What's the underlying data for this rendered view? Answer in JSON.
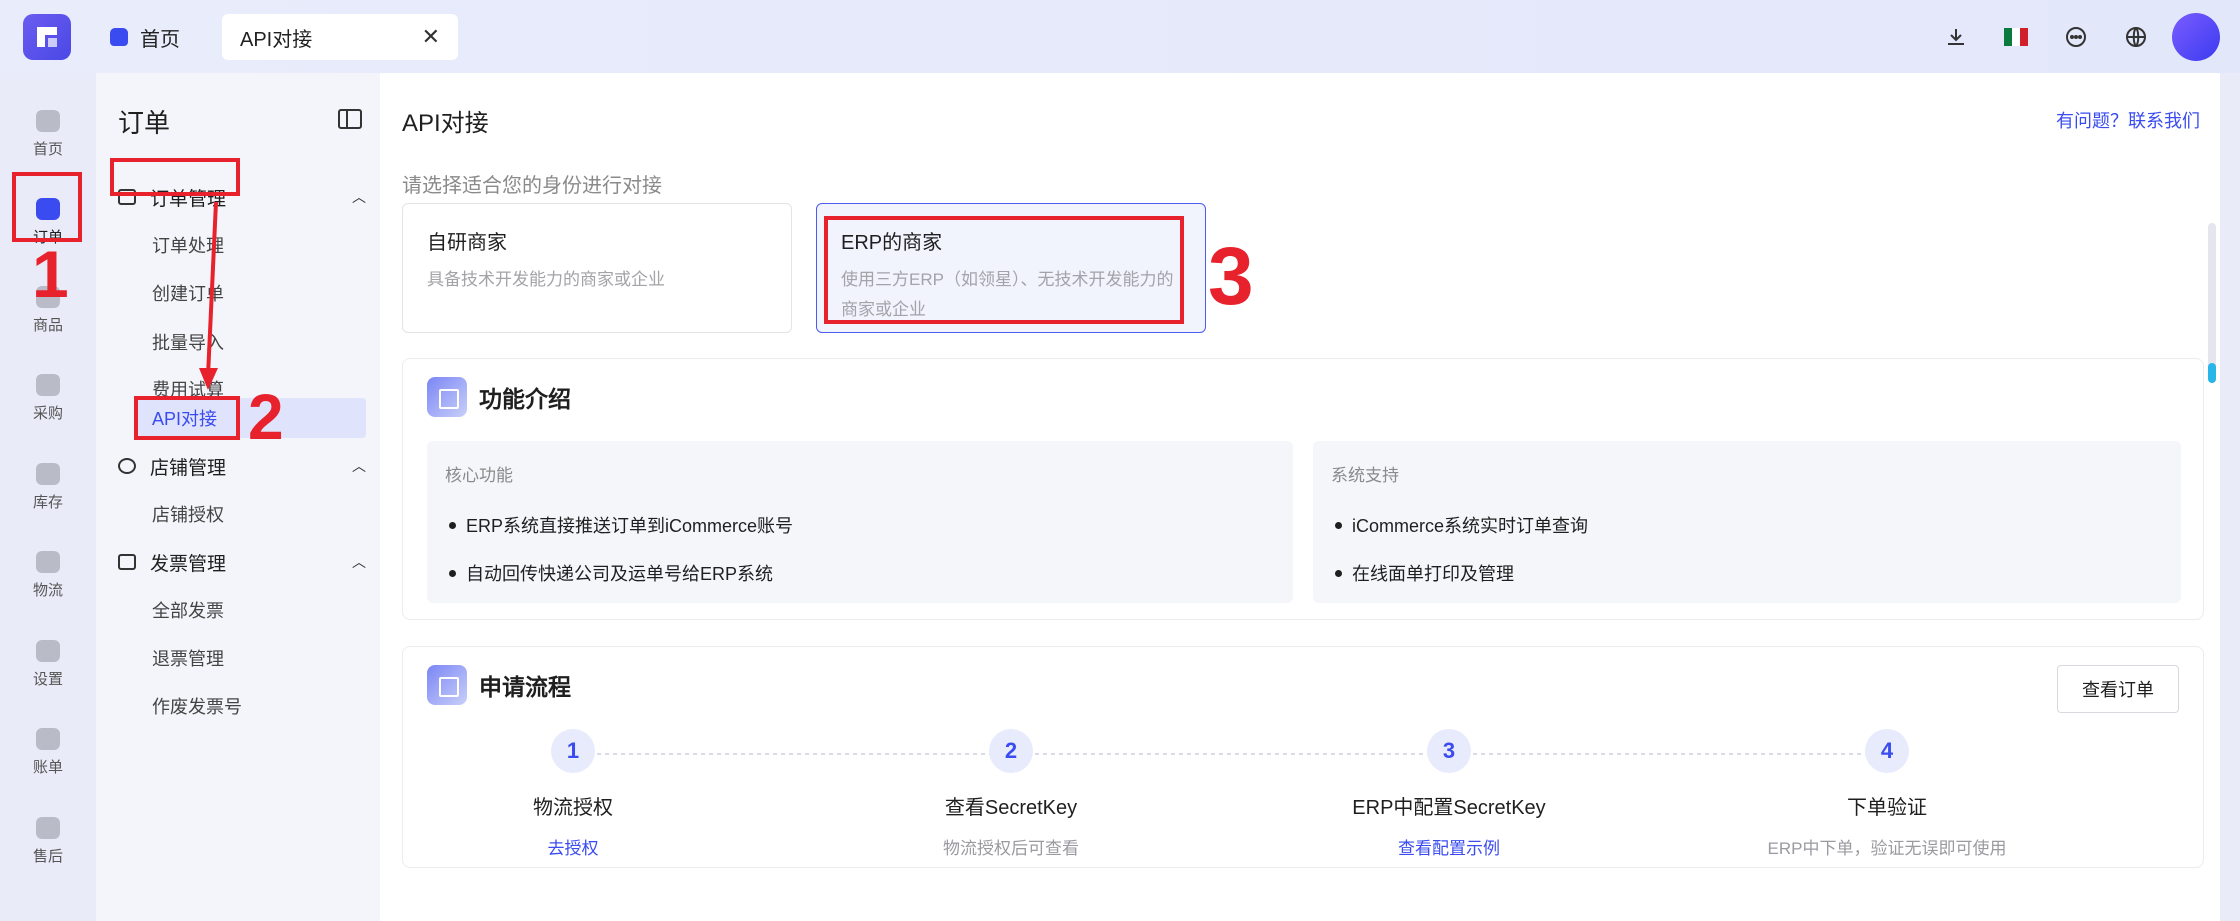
{
  "topbar": {
    "home_tab_label": "首页",
    "active_tab_label": "API对接",
    "close_glyph": "✕"
  },
  "rail": {
    "items": [
      {
        "label": "首页",
        "icon": "home-icon"
      },
      {
        "label": "订单",
        "icon": "order-icon"
      },
      {
        "label": "商品",
        "icon": "product-icon"
      },
      {
        "label": "采购",
        "icon": "purchase-icon"
      },
      {
        "label": "库存",
        "icon": "warehouse-icon"
      },
      {
        "label": "物流",
        "icon": "logistics-icon"
      },
      {
        "label": "设置",
        "icon": "settings-icon"
      },
      {
        "label": "账单",
        "icon": "bill-icon"
      },
      {
        "label": "售后",
        "icon": "after-sales-icon"
      }
    ]
  },
  "sidebar": {
    "title": "订单",
    "groups": [
      {
        "label": "订单管理",
        "children": [
          "订单处理",
          "创建订单",
          "批量导入",
          "费用试算",
          "API对接"
        ]
      },
      {
        "label": "店铺管理",
        "children": [
          "店铺授权"
        ]
      },
      {
        "label": "发票管理",
        "children": [
          "全部发票",
          "退票管理",
          "作废发票号"
        ]
      }
    ]
  },
  "main": {
    "title": "API对接",
    "help_link": "有问题？联系我们",
    "choose_label": "请选择适合您的身份进行对接",
    "identities": [
      {
        "title": "自研商家",
        "desc": "具备技术开发能力的商家或企业"
      },
      {
        "title": "ERP的商家",
        "desc": "使用三方ERP（如领星）、无技术开发能力的商家或企业"
      }
    ],
    "features": {
      "title": "功能介绍",
      "core_title": "核心功能",
      "core_items": [
        "ERP系统直接推送订单到iCommerce账号",
        "自动回传快递公司及运单号给ERP系统"
      ],
      "support_title": "系统支持",
      "support_items": [
        "iCommerce系统实时订单查询",
        "在线面单打印及管理"
      ]
    },
    "process": {
      "title": "申请流程",
      "view_orders_btn": "查看订单",
      "steps": [
        {
          "num": "1",
          "title": "物流授权",
          "sub": "去授权",
          "link": true
        },
        {
          "num": "2",
          "title": "查看SecretKey",
          "sub": "物流授权后可查看",
          "link": false
        },
        {
          "num": "3",
          "title": "ERP中配置SecretKey",
          "sub": "查看配置示例",
          "link": true
        },
        {
          "num": "4",
          "title": "下单验证",
          "sub": "ERP中下单，验证无误即可使用",
          "link": false
        }
      ]
    }
  },
  "annotations": {
    "labels": [
      "1",
      "2",
      "3"
    ],
    "color": "#e8222c"
  },
  "colors": {
    "accent": "#3a4cf0",
    "annotation": "#e8222c"
  }
}
